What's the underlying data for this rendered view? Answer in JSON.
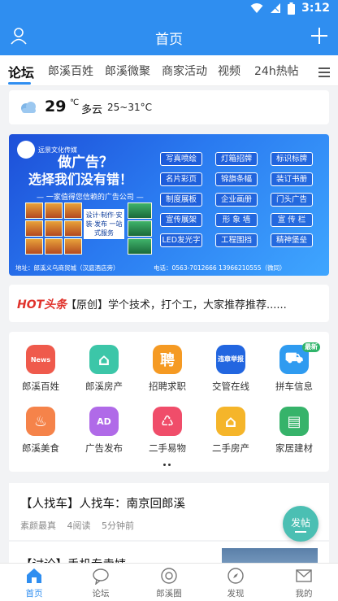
{
  "status_bar": {
    "time": "3:12"
  },
  "header": {
    "title": "首页"
  },
  "tabs": [
    {
      "label": "论坛",
      "active": true
    },
    {
      "label": "郎溪百姓"
    },
    {
      "label": "郎溪微聚"
    },
    {
      "label": "商家活动"
    },
    {
      "label": "视频"
    },
    {
      "label": "24h热帖"
    }
  ],
  "weather": {
    "temp": "29",
    "unit": "℃",
    "condition": "多云",
    "range": "25~31°C"
  },
  "banner": {
    "brand": "远景文化传媒",
    "headline1": "做广告？",
    "headline2": "选择我们没有错！",
    "subline": "— 一家值得您信赖的广告公司 —",
    "services_tag": "设计·制作·安装·发布 一站式服务",
    "services": [
      "写真喷绘",
      "灯箱招牌",
      "标识标牌",
      "名片彩页",
      "锦旗条幅",
      "装订书册",
      "制度展板",
      "企业画册",
      "门头广告",
      "宣传展架",
      "形 象 墙",
      "宣 传 栏",
      "LED发光字",
      "工程围挡",
      "精神堡垒"
    ],
    "address": "地址：郎溪义乌商贸城（汉庭酒店旁）",
    "phone": "电话：0563-7012666   13966210555（微同）"
  },
  "hot_news": {
    "label": "HOT头条",
    "text": "【原创】学个技术，打个工，大家推荐推荐......"
  },
  "grid": [
    {
      "label": "郎溪百姓",
      "icon": "news-icon",
      "color": "#ef5a4c",
      "glyph": "News"
    },
    {
      "label": "郎溪房产",
      "icon": "house-icon",
      "color": "#3cc6a8",
      "glyph": "⌂"
    },
    {
      "label": "招聘求职",
      "icon": "recruit-icon",
      "color": "#f59a23",
      "glyph": "聘"
    },
    {
      "label": "交管在线",
      "icon": "traffic-icon",
      "color": "#2266e0",
      "glyph": "违章举报"
    },
    {
      "label": "拼车信息",
      "icon": "carpool-icon",
      "color": "#2f9bf0",
      "glyph": "⛟",
      "badge": "最新"
    },
    {
      "label": "郎溪美食",
      "icon": "food-icon",
      "color": "#f5834a",
      "glyph": "♨"
    },
    {
      "label": "广告发布",
      "icon": "ad-icon",
      "color": "#b06ae8",
      "glyph": "AD"
    },
    {
      "label": "二手易物",
      "icon": "gift-icon",
      "color": "#f04d6a",
      "glyph": "♺"
    },
    {
      "label": "二手房产",
      "icon": "home-icon",
      "color": "#f5b52a",
      "glyph": "⌂"
    },
    {
      "label": "家居建材",
      "icon": "paint-icon",
      "color": "#36b36a",
      "glyph": "▤"
    }
  ],
  "post": {
    "title": "【人找车】人找车：南京回郎溪",
    "author": "素颜最真",
    "reads": "4阅读",
    "time": "5分钟前"
  },
  "post2": {
    "title": "【讨论】手机专卖婊..."
  },
  "fab": {
    "label": "发帖"
  },
  "bottom_nav": [
    {
      "label": "首页",
      "icon": "home-icon",
      "active": true
    },
    {
      "label": "论坛",
      "icon": "chat-icon"
    },
    {
      "label": "郎溪圈",
      "icon": "circle-icon"
    },
    {
      "label": "发现",
      "icon": "compass-icon"
    },
    {
      "label": "我的",
      "icon": "mail-icon"
    }
  ],
  "colors": {
    "primary": "#2f8ef0",
    "hot": "#e0322b",
    "fab": "#4bbfb3"
  }
}
